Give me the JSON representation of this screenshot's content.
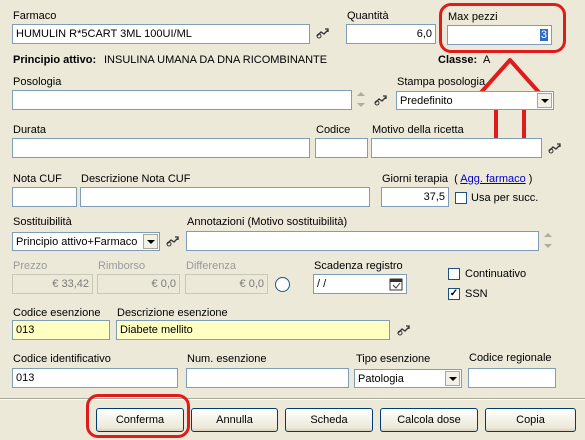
{
  "farmaco": {
    "label": "Farmaco",
    "value": "HUMULIN R*5CART 3ML 100UI/ML"
  },
  "quantita": {
    "label": "Quantità",
    "value": "6,0"
  },
  "max_pezzi": {
    "label": "Max pezzi",
    "value": "3"
  },
  "principio": {
    "label": "Principio attivo:",
    "value": "INSULINA UMANA DA DNA RICOMBINANTE"
  },
  "classe": {
    "label": "Classe:",
    "value": "A"
  },
  "posologia": {
    "label": "Posologia",
    "value": ""
  },
  "stampa_posologia": {
    "label": "Stampa posologia",
    "value": "Predefinito"
  },
  "durata": {
    "label": "Durata",
    "value": ""
  },
  "codice": {
    "label": "Codice",
    "value": ""
  },
  "motivo": {
    "label": "Motivo della ricetta",
    "value": ""
  },
  "nota_cuf": {
    "label": "Nota CUF",
    "value": ""
  },
  "descr_nota_cuf": {
    "label": "Descrizione Nota CUF",
    "value": ""
  },
  "giorni_terapia": {
    "label": "Giorni terapia",
    "paren_open": "(",
    "link": "Agg. farmaco",
    "paren_close": ")",
    "value": "37,5"
  },
  "usa_per_succ": {
    "label": "Usa per succ.",
    "checked": false
  },
  "sostituibilita": {
    "label": "Sostituibilità",
    "value": "Principio attivo+Farmaco"
  },
  "annotazioni": {
    "label": "Annotazioni (Motivo sostituibilità)",
    "value": ""
  },
  "prezzo": {
    "label": "Prezzo",
    "value": "€ 33,42"
  },
  "rimborso": {
    "label": "Rimborso",
    "value": "€ 0,0"
  },
  "differenza": {
    "label": "Differenza",
    "value": "€ 0,0"
  },
  "scadenza": {
    "label": "Scadenza registro",
    "value": "/ /"
  },
  "continuativo": {
    "label": "Continuativo",
    "checked": false
  },
  "ssn": {
    "label": "SSN",
    "checked": true,
    "mark": "✓"
  },
  "codice_esenzione": {
    "label": "Codice esenzione",
    "value": "013"
  },
  "descr_esenzione": {
    "label": "Descrizione esenzione",
    "value": "Diabete mellito"
  },
  "codice_identificativo": {
    "label": "Codice identificativo",
    "value": "013"
  },
  "num_esenzione": {
    "label": "Num. esenzione",
    "value": ""
  },
  "tipo_esenzione": {
    "label": "Tipo esenzione",
    "value": "Patologia"
  },
  "codice_regionale": {
    "label": "Codice regionale",
    "value": ""
  },
  "buttons": {
    "conferma": "Conferma",
    "annulla": "Annulla",
    "scheda": "Scheda",
    "calcola": "Calcola dose",
    "copia": "Copia"
  },
  "colors": {
    "highlight": "#e01b1b",
    "required_field": "#ffffc2",
    "window_bg": "#ece9d8"
  }
}
